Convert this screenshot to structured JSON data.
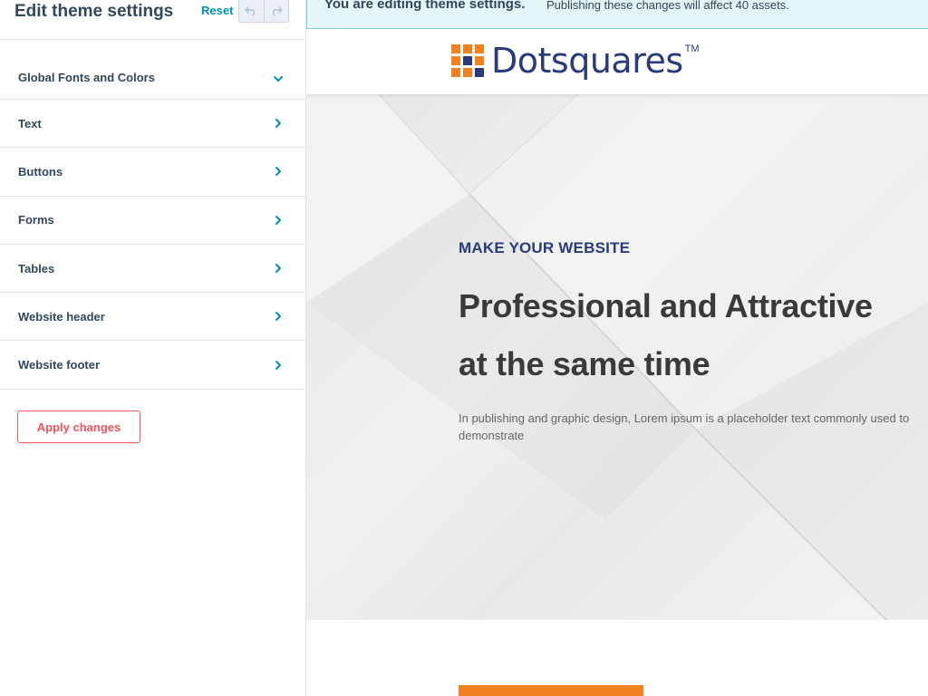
{
  "panel": {
    "title": "Edit theme settings",
    "reset_label": "Reset",
    "undo_icon": "undo-icon",
    "redo_icon": "redo-icon",
    "menu": [
      {
        "label": "Global Fonts and Colors",
        "icon": "chevron-down-icon"
      },
      {
        "label": "Text",
        "icon": "chevron-right-icon"
      },
      {
        "label": "Buttons",
        "icon": "chevron-right-icon"
      },
      {
        "label": "Forms",
        "icon": "chevron-right-icon"
      },
      {
        "label": "Tables",
        "icon": "chevron-right-icon"
      },
      {
        "label": "Website header",
        "icon": "chevron-right-icon"
      },
      {
        "label": "Website footer",
        "icon": "chevron-right-icon"
      }
    ],
    "apply_label": "Apply changes"
  },
  "banner": {
    "strong": "You are editing theme settings.",
    "text": "Publishing these changes will affect 40 assets."
  },
  "site": {
    "logo_text": "Dotsquares",
    "logo_tm": "TM",
    "hero": {
      "kicker": "MAKE YOUR WEBSITE",
      "title_line1": "Professional and Attractive",
      "title_line2": "at the same time",
      "body": "In publishing and graphic design, Lorem ipsum is a placeholder text commonly used to demonstrate"
    }
  },
  "colors": {
    "accent_teal": "#0091ae",
    "accent_coral": "#f2545b",
    "brand_orange": "#f48120",
    "brand_navy": "#2a3b7c",
    "text_dark": "#33475b"
  }
}
